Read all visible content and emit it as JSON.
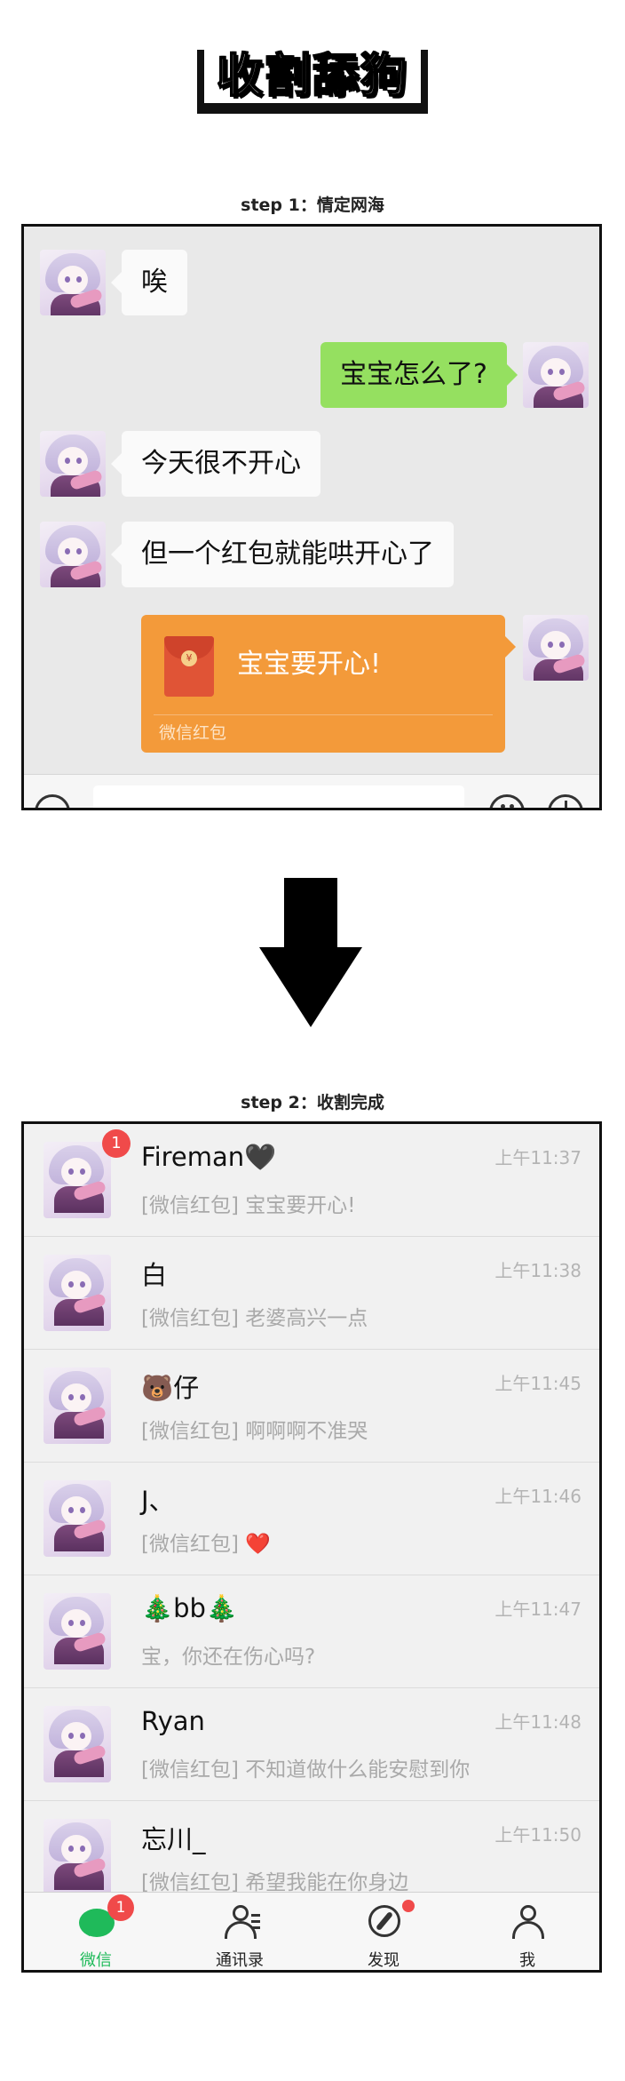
{
  "title": "收割舔狗",
  "step1": {
    "label": "step 1：情定网海",
    "messages": [
      {
        "side": "in",
        "text": "唉"
      },
      {
        "side": "out",
        "text": "宝宝怎么了?"
      },
      {
        "side": "in",
        "text": "今天很不开心"
      },
      {
        "side": "in",
        "text": "但一个红包就能哄开心了"
      }
    ],
    "red_packet": {
      "greeting": "宝宝要开心!",
      "label": "微信红包",
      "coin": "¥"
    }
  },
  "step2": {
    "label": "step 2：收割完成",
    "chats": [
      {
        "name": "Fireman🖤",
        "time": "上午11:37",
        "preview": "[微信红包] 宝宝要开心!",
        "unread": "1"
      },
      {
        "name": "白",
        "time": "上午11:38",
        "preview": "[微信红包] 老婆高兴一点"
      },
      {
        "name": "🐻仔",
        "time": "上午11:45",
        "preview": "[微信红包] 啊啊啊不准哭"
      },
      {
        "name": "J、",
        "time": "上午11:46",
        "preview": "[微信红包] ❤️"
      },
      {
        "name": "🎄bb🎄",
        "time": "上午11:47",
        "preview": "宝，你还在伤心吗?"
      },
      {
        "name": "Ryan",
        "time": "上午11:48",
        "preview": "[微信红包] 不知道做什么能安慰到你"
      },
      {
        "name": "忘川_",
        "time": "上午11:50",
        "preview": "[微信红包] 希望我能在你身边"
      }
    ],
    "tabs": [
      {
        "label": "微信",
        "icon": "chat-bubble-icon",
        "badge": "1",
        "active": true
      },
      {
        "label": "通讯录",
        "icon": "contacts-icon"
      },
      {
        "label": "发现",
        "icon": "compass-icon",
        "dot": true
      },
      {
        "label": "我",
        "icon": "profile-icon"
      }
    ]
  },
  "colors": {
    "wechat_green": "#1fba5a",
    "bubble_green": "#95e060",
    "red_packet": "#f39a3a",
    "badge_red": "#f04a4a"
  }
}
